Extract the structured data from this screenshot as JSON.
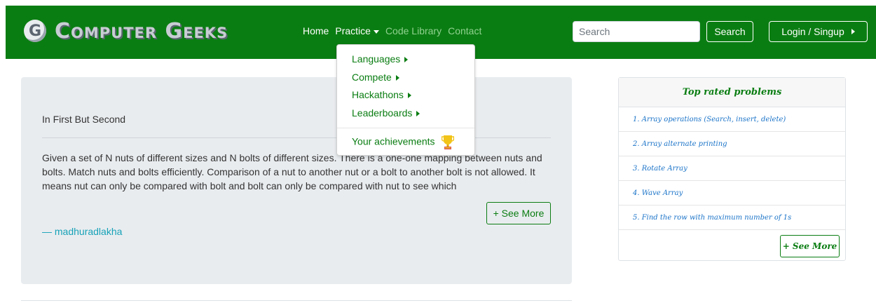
{
  "brand": {
    "icon_letter": "G",
    "name": "Computer Geeks"
  },
  "nav": {
    "home": "Home",
    "practice": "Practice",
    "code_library": "Code Library",
    "contact": "Contact"
  },
  "search": {
    "placeholder": "Search",
    "button": "Search"
  },
  "login": {
    "label": "Login / Singup"
  },
  "dropdown": {
    "items": [
      "Languages",
      "Compete",
      "Hackathons",
      "Leaderboards"
    ],
    "achievements": "Your achievements"
  },
  "problem": {
    "title": "In First But Second",
    "description": "Given a set of N nuts of different sizes and N bolts of different sizes. There is a one-one mapping between nuts and bolts. Match nuts and bolts efficiently. Comparison of a nut to another nut or a bolt to another bolt is not allowed. It means nut can only be compared with bolt and bolt can only be compared with nut to see which",
    "see_more": "+ See More",
    "author": "— madhuradlakha"
  },
  "sidebar": {
    "title": "Top rated problems",
    "items": [
      "1. Array operations (Search, insert, delete)",
      "2. Array alternate printing",
      "3. Rotate Array",
      "4. Wave Array",
      "5. Find the row with maximum number of 1s"
    ],
    "see_more": "+ See More"
  },
  "colors": {
    "brand_green": "#0a7d12",
    "card_bg": "#e9ecef",
    "link_blue": "#1a73c8",
    "author_teal": "#17a2b8"
  },
  "icons": {
    "trophy": "trophy-icon"
  }
}
